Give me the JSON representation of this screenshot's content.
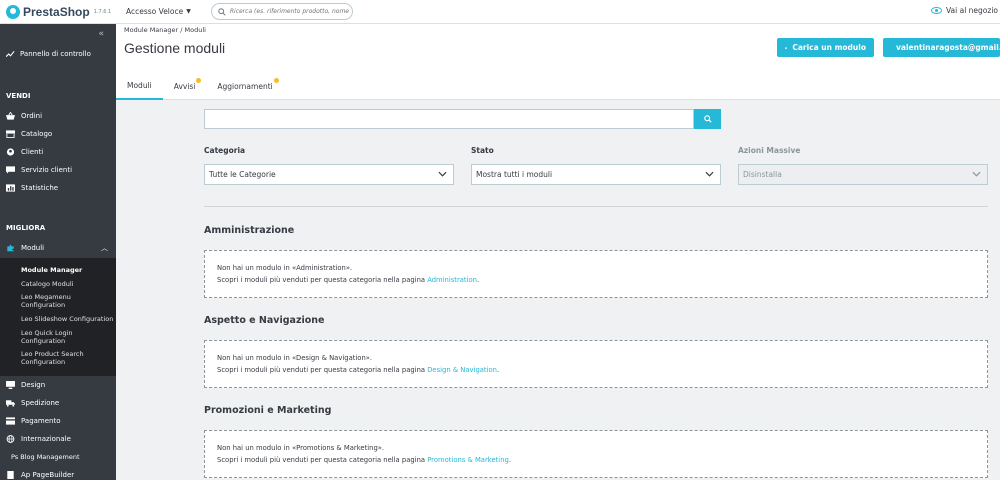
{
  "brand": {
    "name": "PrestaShop",
    "version": "1.7.6.1"
  },
  "topbar": {
    "quick_access": "Accesso Veloce",
    "search_placeholder": "Ricerca (es. riferimento prodotto, nome",
    "shop_link": "Vai al negozio"
  },
  "sidebar": {
    "dashboard": "Pannello di controllo",
    "sections": [
      {
        "title": "VENDI",
        "items": [
          "Ordini",
          "Catalogo",
          "Clienti",
          "Servizio clienti",
          "Statistiche"
        ]
      },
      {
        "title": "MIGLIORA"
      }
    ],
    "moduli": {
      "label": "Moduli",
      "subitems": [
        "Module Manager",
        "Catalogo Moduli",
        "Leo Megamenu Configuration",
        "Leo Slideshow Configuration",
        "Leo Quick Login Configuration",
        "Leo Product Search Configuration"
      ]
    },
    "after": [
      "Design",
      "Spedizione",
      "Pagamento",
      "Internazionale",
      "Ps Blog Management",
      "Ap PageBuilder"
    ]
  },
  "header": {
    "breadcrumb": "Module Manager  /  Moduli",
    "title": "Gestione moduli",
    "upload_button": "Carica un modulo",
    "account_button": "valentinaragosta@gmail.com",
    "tabs": [
      "Moduli",
      "Avvisi",
      "Aggiornamenti"
    ]
  },
  "filters": {
    "categoria": {
      "label": "Categoria",
      "value": "Tutte le Categorie"
    },
    "stato": {
      "label": "Stato",
      "value": "Mostra tutti i moduli"
    },
    "azioni": {
      "label": "Azioni Massive",
      "value": "Disinstalla"
    }
  },
  "categories": [
    {
      "title": "Amministrazione",
      "line1": "Non hai un modulo in «Administration».",
      "line2": "Scopri i moduli più venduti per questa categoria nella pagina ",
      "link": "Administration"
    },
    {
      "title": "Aspetto e Navigazione",
      "line1": "Non hai un modulo in «Design & Navigation».",
      "line2": "Scopri i moduli più venduti per questa categoria nella pagina ",
      "link": "Design & Navigation"
    },
    {
      "title": "Promozioni e Marketing",
      "line1": "Non hai un modulo in «Promotions & Marketing».",
      "line2": "Scopri i moduli più venduti per questa categoria nella pagina ",
      "link": "Promotions & Marketing"
    }
  ],
  "colors": {
    "accent": "#25b9d7",
    "sidebar": "#363a41",
    "badge": "#fbbb22"
  }
}
